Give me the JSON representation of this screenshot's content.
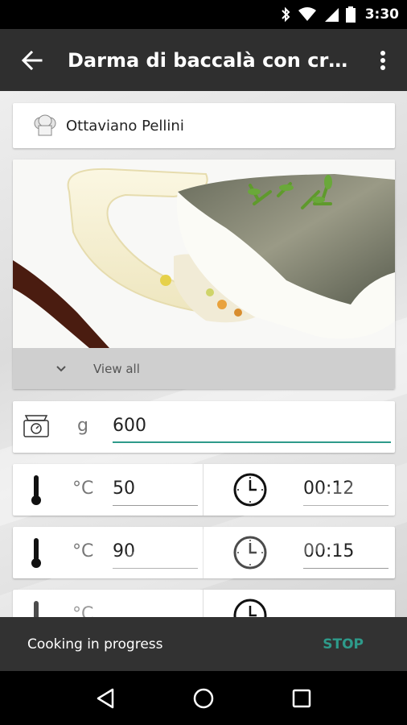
{
  "status_bar": {
    "time": "3:30",
    "icons": [
      "bluetooth-icon",
      "wifi-icon",
      "signal-icon",
      "battery-icon"
    ]
  },
  "app_bar": {
    "title": "Darma di baccalà con crem…",
    "back_icon": "arrow-back-icon",
    "menu_icon": "more-vert-icon"
  },
  "recipe": {
    "chef": "Ottaviano Pellini",
    "view_all_label": "View all",
    "weight": {
      "unit": "g",
      "value": "600"
    },
    "steps": [
      {
        "temp_unit": "°C",
        "temperature": "50",
        "time": "00:12"
      },
      {
        "temp_unit": "°C",
        "temperature": "90",
        "time": "00:15"
      },
      {
        "temp_unit": "°C",
        "temperature": "",
        "time": ""
      }
    ]
  },
  "snackbar": {
    "message": "Cooking in progress",
    "action": "STOP"
  },
  "colors": {
    "accent": "#2e9a8a",
    "app_bar": "#2f2f2f",
    "snackbar": "#323232"
  }
}
